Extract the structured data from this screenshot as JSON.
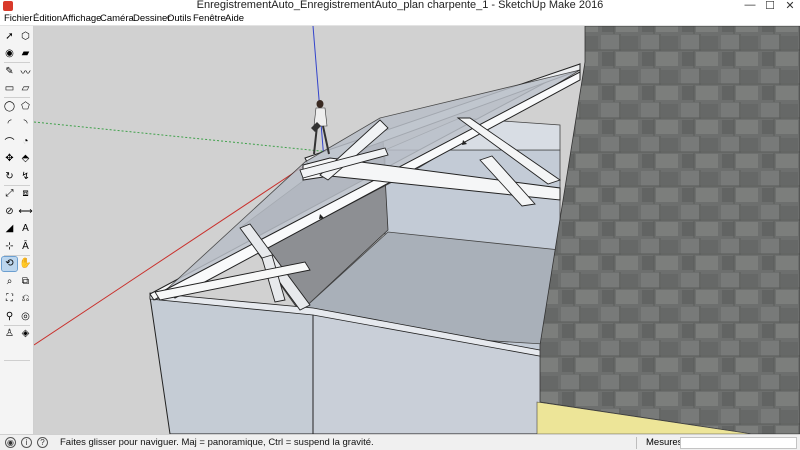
{
  "window": {
    "title": "EnregistrementAuto_EnregistrementAuto_plan charpente_1 - SketchUp Make 2016",
    "app_icon": "sketchup-logo-icon",
    "controls": {
      "minimize": "—",
      "maximize": "☐",
      "close": "✕"
    }
  },
  "menubar": {
    "items": [
      "Fichier",
      "Édition",
      "Affichage",
      "Caméra",
      "Dessiner",
      "Outils",
      "Fenêtre",
      "Aide"
    ]
  },
  "toolbar": {
    "tools": [
      {
        "name": "select-tool-icon",
        "glyph": "➚"
      },
      {
        "name": "make-component-tool-icon",
        "glyph": "⬡"
      },
      {
        "name": "paint-bucket-tool-icon",
        "glyph": "◉"
      },
      {
        "name": "eraser-tool-icon",
        "glyph": "▰"
      },
      {
        "name": "line-tool-icon",
        "glyph": "✎"
      },
      {
        "name": "freehand-tool-icon",
        "glyph": "〰"
      },
      {
        "name": "rectangle-tool-icon",
        "glyph": "▭"
      },
      {
        "name": "rotated-rectangle-tool-icon",
        "glyph": "▱"
      },
      {
        "name": "circle-tool-icon",
        "glyph": "◯"
      },
      {
        "name": "polygon-tool-icon",
        "glyph": "⬠"
      },
      {
        "name": "arc-tool-icon",
        "glyph": "◜"
      },
      {
        "name": "two-point-arc-tool-icon",
        "glyph": "◝"
      },
      {
        "name": "three-point-arc-tool-icon",
        "glyph": "⌒"
      },
      {
        "name": "pie-tool-icon",
        "glyph": "◔"
      },
      {
        "name": "move-tool-icon",
        "glyph": "✥"
      },
      {
        "name": "push-pull-tool-icon",
        "glyph": "⬘"
      },
      {
        "name": "rotate-tool-icon",
        "glyph": "↻"
      },
      {
        "name": "follow-me-tool-icon",
        "glyph": "↯"
      },
      {
        "name": "scale-tool-icon",
        "glyph": "⤢"
      },
      {
        "name": "offset-tool-icon",
        "glyph": "⧈"
      },
      {
        "name": "tape-measure-tool-icon",
        "glyph": "⊘"
      },
      {
        "name": "dimension-tool-icon",
        "glyph": "⟷"
      },
      {
        "name": "protractor-tool-icon",
        "glyph": "◢"
      },
      {
        "name": "text-tool-icon",
        "glyph": "A"
      },
      {
        "name": "axes-tool-icon",
        "glyph": "⊹"
      },
      {
        "name": "3d-text-tool-icon",
        "glyph": "Ā"
      },
      {
        "name": "orbit-tool-icon",
        "glyph": "⟲"
      },
      {
        "name": "pan-tool-icon",
        "glyph": "✋"
      },
      {
        "name": "zoom-tool-icon",
        "glyph": "⌕"
      },
      {
        "name": "zoom-window-tool-icon",
        "glyph": "⧉"
      },
      {
        "name": "zoom-extents-tool-icon",
        "glyph": "⛶"
      },
      {
        "name": "previous-view-tool-icon",
        "glyph": "⎌"
      },
      {
        "name": "position-camera-tool-icon",
        "glyph": "⚲"
      },
      {
        "name": "look-around-tool-icon",
        "glyph": "◎"
      },
      {
        "name": "walk-tool-icon",
        "glyph": "♙"
      },
      {
        "name": "section-plane-tool-icon",
        "glyph": "◈"
      }
    ],
    "active_tool": "orbit-tool-icon"
  },
  "viewport": {
    "sky_color": "#d1d1d1",
    "wall_color": "#c4ccd6",
    "beam_color": "#f7f8f8",
    "stone_wall_color": "#6d6f6e",
    "floor_color": "#ede598",
    "axis_red": "#c9302c",
    "axis_green": "#3fa14a",
    "axis_blue": "#3344cc"
  },
  "statusbar": {
    "icons": [
      "geo-location-icon",
      "credits-icon",
      "help-icon"
    ],
    "hint": "Faites glisser pour naviguer. Maj = panoramique, Ctrl =  suspend la gravité.",
    "measurements_label": "Mesures",
    "measurements_value": ""
  }
}
